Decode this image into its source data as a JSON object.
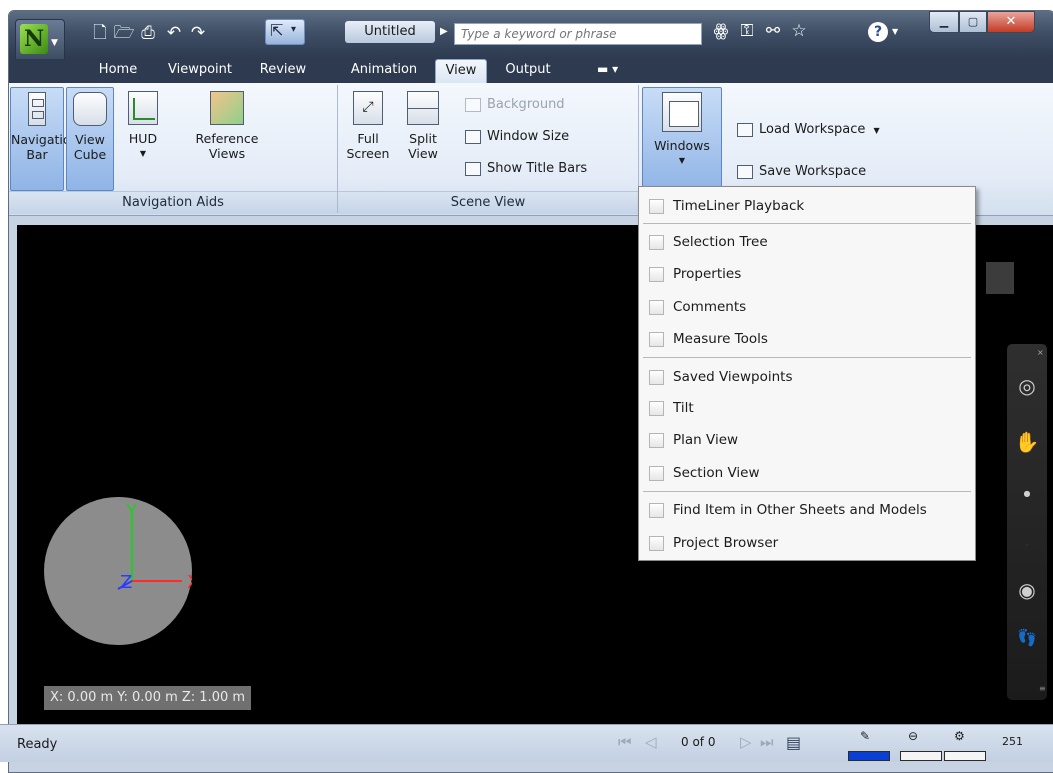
{
  "window": {
    "title": "Untitled",
    "search_placeholder": "Type a keyword or phrase"
  },
  "tabs": [
    "Home",
    "Viewpoint",
    "Review",
    "Animation",
    "View",
    "Output"
  ],
  "ribbon": {
    "navigation_aids": {
      "title": "Navigation Aids",
      "navigation_bar": [
        "Navigation",
        "Bar"
      ],
      "view_cube": [
        "View",
        "Cube"
      ],
      "hud": "HUD",
      "reference_views": [
        "Reference",
        "Views"
      ]
    },
    "scene_view": {
      "title": "Scene View",
      "full_screen": [
        "Full",
        "Screen"
      ],
      "split_view": [
        "Split",
        "View"
      ],
      "background": "Background",
      "window_size": "Window Size",
      "show_title_bars": "Show Title Bars"
    },
    "workspace": {
      "windows": "Windows",
      "load_workspace": "Load Workspace",
      "save_workspace": "Save Workspace"
    }
  },
  "windows_menu": {
    "items": [
      "TimeLiner Playback",
      "Selection Tree",
      "Properties",
      "Comments",
      "Measure Tools",
      "Saved Viewpoints",
      "Tilt",
      "Plan View",
      "Section View",
      "Find Item in Other Sheets and Models",
      "Project Browser"
    ]
  },
  "viewport": {
    "axis_y": "Y",
    "axis_z": "Z",
    "axis_x": "X",
    "coordinates": "X: 0.00 m  Y: 0.00 m  Z: 1.00 m"
  },
  "statusbar": {
    "status": "Ready",
    "sheet_counter": "0 of 0",
    "memory": "251"
  },
  "colors": {
    "title_bar": "#3f4f66",
    "ribbon": "#e4ecf7",
    "viewport": "#000000",
    "axis_x": "#ff2a2a",
    "axis_y": "#22cc22",
    "axis_z": "#2a3cff"
  }
}
